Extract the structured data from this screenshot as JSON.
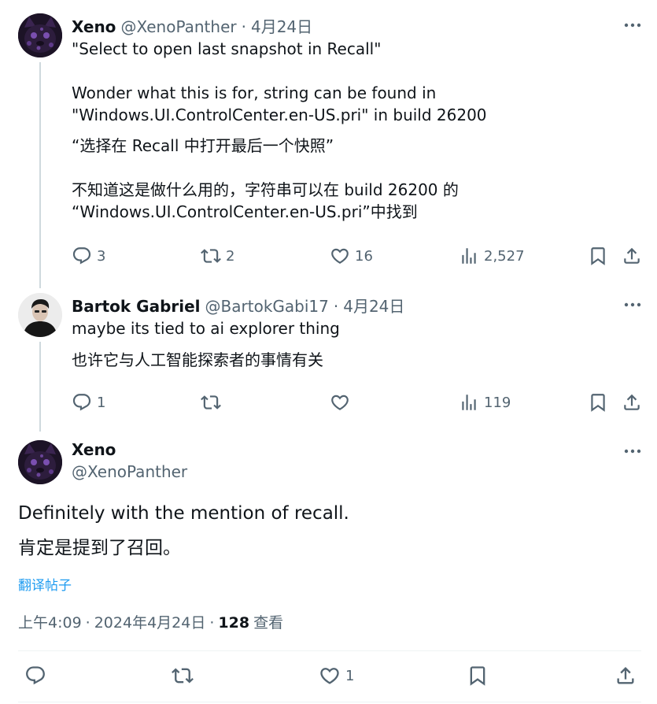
{
  "tweet1": {
    "name": "Xeno",
    "handle": "@XenoPanther",
    "separator": "·",
    "date": "4月24日",
    "text_line1": "\"Select to open last snapshot in Recall\"",
    "text_para2": "Wonder what this is for, string can be found in\n\"Windows.UI.ControlCenter.en-US.pri\" in build 26200",
    "translation_line1": "“选择在 Recall 中打开最后一个快照”",
    "translation_para2": "不知道这是做什么用的，字符串可以在 build 26200 的\n“Windows.UI.ControlCenter.en-US.pri”中找到",
    "replies": "3",
    "reposts": "2",
    "likes": "16",
    "views": "2,527"
  },
  "tweet2": {
    "name": "Bartok Gabriel",
    "handle": "@BartokGabi17",
    "separator": "·",
    "date": "4月24日",
    "text": "maybe its tied to ai explorer thing",
    "translation": "也许它与人工智能探索者的事情有关",
    "replies": "1",
    "views": "119"
  },
  "main_tweet": {
    "name": "Xeno",
    "handle": "@XenoPanther",
    "text": "Definitely with the mention of recall.",
    "translation": "肯定是提到了召回。",
    "translate_link": "翻译帖子",
    "time": "上午4:09",
    "separator": "·",
    "date": "2024年4月24日",
    "views_count": "128",
    "views_label": "查看",
    "likes": "1"
  },
  "icons": [
    "more-icon",
    "reply-icon",
    "repost-icon",
    "like-icon",
    "views-icon",
    "bookmark-icon",
    "share-icon"
  ],
  "colors": {
    "text": "#0f1419",
    "secondary": "#536471",
    "link": "#1d9bf0",
    "line": "#cfd9de"
  }
}
